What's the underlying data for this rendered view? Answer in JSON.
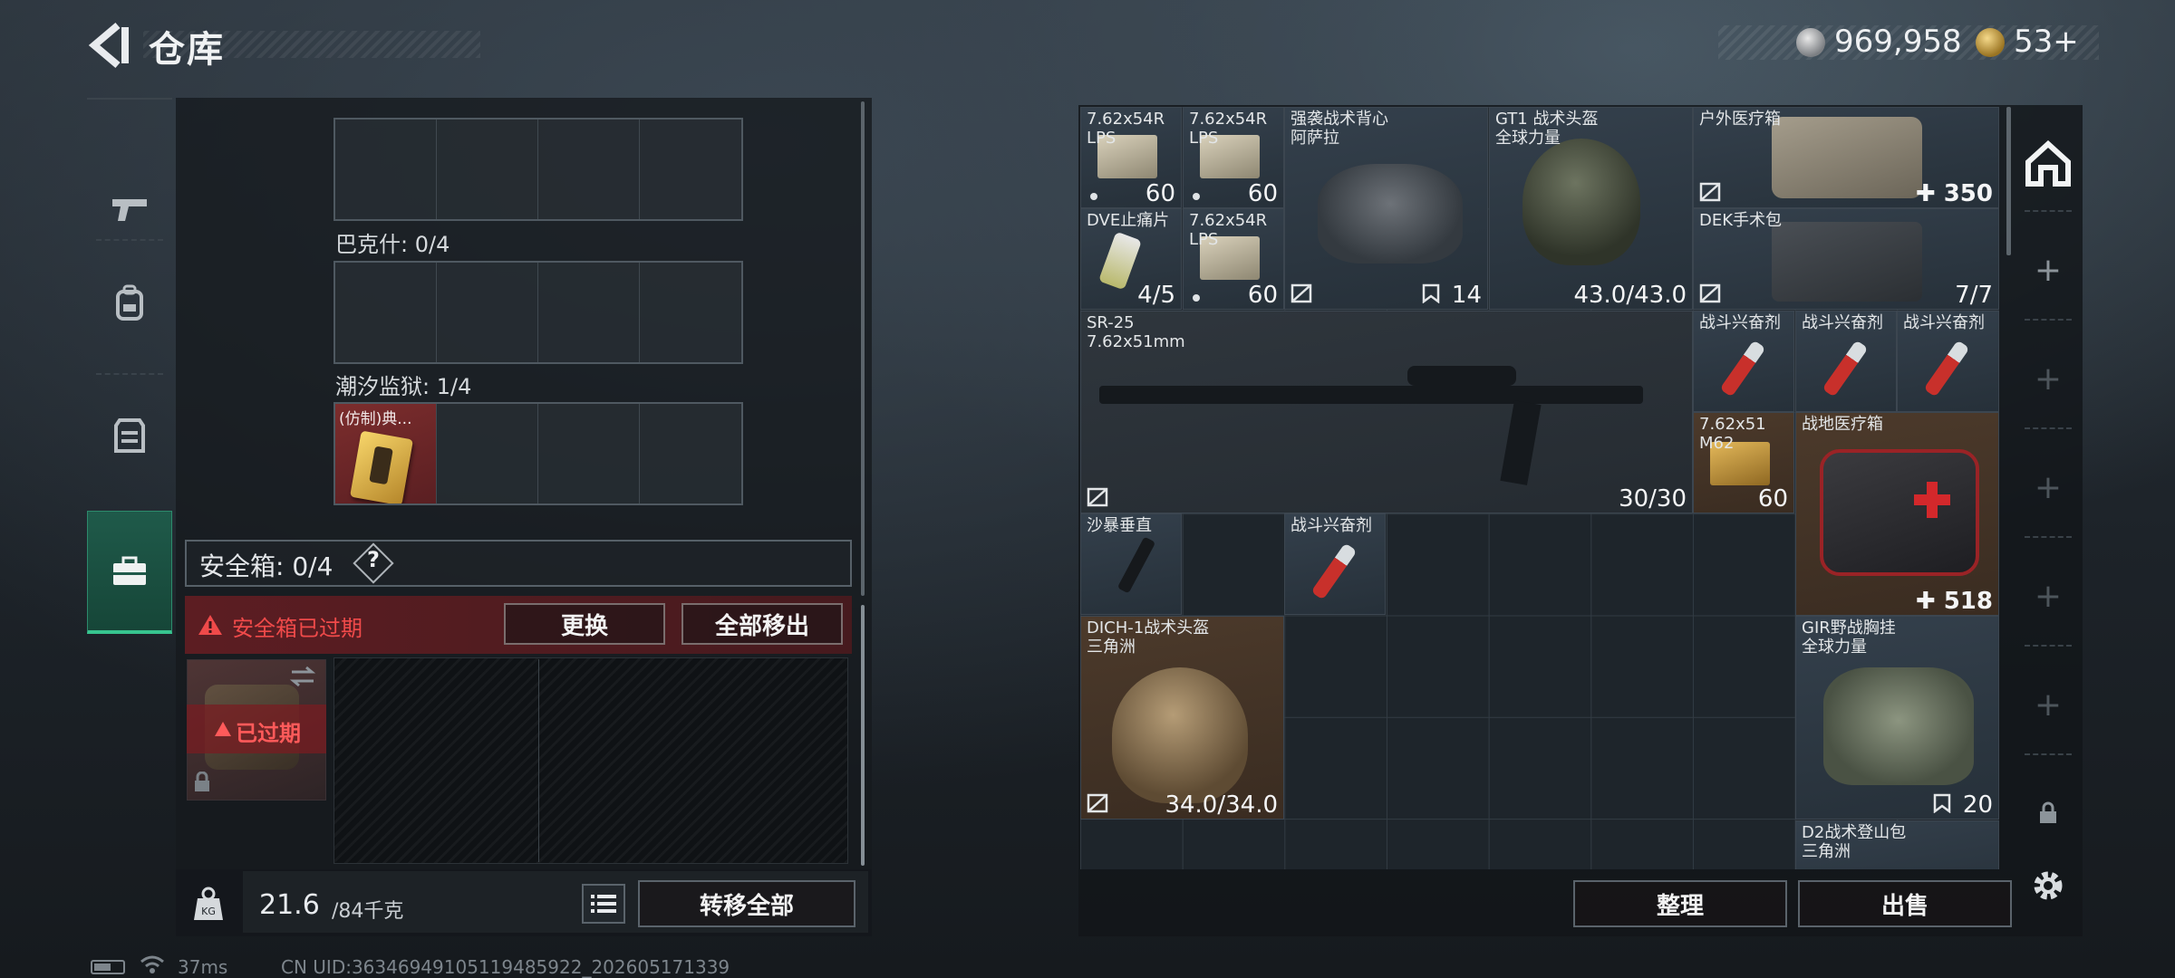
{
  "header": {
    "title": "仓库",
    "currency": {
      "silver": "969,958",
      "gold": "53+"
    }
  },
  "left_panel": {
    "containers": [
      {
        "label": "巴克什: 0/4"
      },
      {
        "label": "潮汐监狱: 1/4",
        "item_name": "(仿制)典..."
      }
    ],
    "safebox": {
      "label": "安全箱: 0/4",
      "help": "?",
      "expired_text": "安全箱已过期",
      "replace_btn": "更换",
      "move_all_btn": "全部移出",
      "tile_tag": "已过期"
    },
    "weight": {
      "current": "21.6",
      "max": "/84千克"
    },
    "transfer_all_btn": "转移全部"
  },
  "status_bar": {
    "ping": "37ms",
    "uid": "CN UID:3634694910511948592​2_202605171339"
  },
  "inventory": {
    "items": [
      {
        "name": "7.62x54R\nLPS",
        "count": "60"
      },
      {
        "name": "7.62x54R\nLPS",
        "count": "60"
      },
      {
        "name": "强袭战术背心\n阿萨拉",
        "count": "14"
      },
      {
        "name": "GT1 战术头盔\n全球力量",
        "count": "43.0/43.0"
      },
      {
        "name": "户外医疗箱",
        "count": "350"
      },
      {
        "name": "DVE止痛片",
        "count": "4/5"
      },
      {
        "name": "7.62x54R\nLPS",
        "count": "60"
      },
      {
        "name": "DEK手术包",
        "count": "7/7"
      },
      {
        "name": "SR-25\n7.62x51mm",
        "count": "30/30"
      },
      {
        "name": "战斗兴奋剂"
      },
      {
        "name": "战斗兴奋剂"
      },
      {
        "name": "战斗兴奋剂"
      },
      {
        "name": "7.62x51\nM62",
        "count": "60"
      },
      {
        "name": "战地医疗箱",
        "count": "518"
      },
      {
        "name": "沙暴垂直"
      },
      {
        "name": "战斗兴奋剂"
      },
      {
        "name": "DICH-1战术头盔\n三角洲",
        "count": "34.0/34.0"
      },
      {
        "name": "GIR野战胸挂\n全球力量",
        "count": "20"
      },
      {
        "name": "D2战术登山包\n三角洲"
      }
    ],
    "sort_btn": "整理",
    "sell_btn": "出售"
  },
  "colors": {
    "accent_green": "#37c48f",
    "warning_red": "#f04a4a",
    "item_blue": "#34404c",
    "item_brown": "#4c3a2b"
  },
  "icons": {
    "left_nav": [
      "gun-icon",
      "backpack-icon",
      "vest-icon",
      "toolbox-icon"
    ],
    "right_nav": [
      "safehouse-icon",
      "add-icon",
      "lock-icon",
      "settings-icon"
    ]
  }
}
